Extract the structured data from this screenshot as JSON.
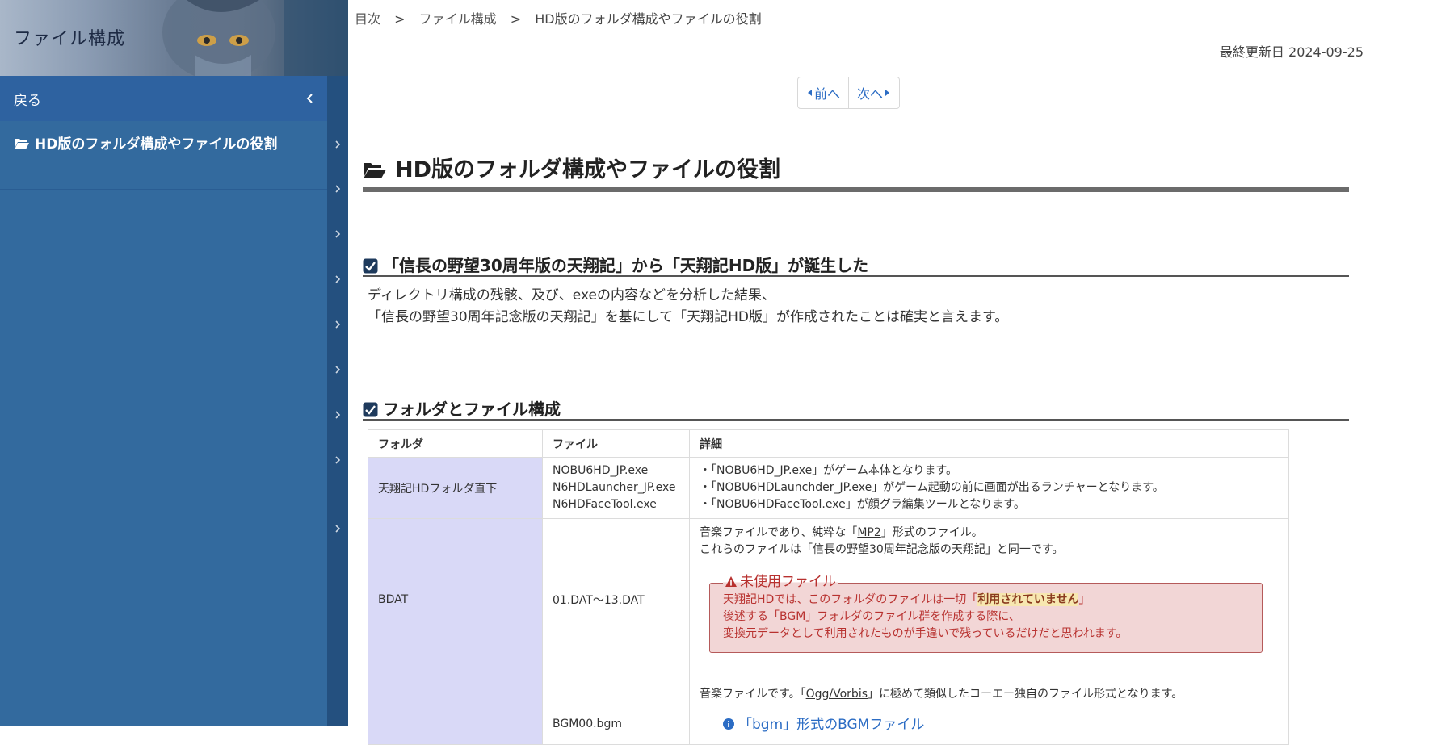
{
  "sidebar": {
    "title": "ファイル構成",
    "back_label": "戻る",
    "current_item": "HD版のフォルダ構成やファイルの役割",
    "rail_chevrons": 9
  },
  "breadcrumb": {
    "items": [
      "目次",
      "ファイル構成",
      "HD版のフォルダ構成やファイルの役割"
    ],
    "separator": ">"
  },
  "updated": "最終更新日 2024-09-25",
  "pager": {
    "prev": "前へ",
    "next": "次へ"
  },
  "page_heading": "HD版のフォルダ構成やファイルの役割",
  "sections": [
    {
      "title": "「信長の野望30周年版の天翔記」から「天翔記HD版」が誕生した"
    },
    {
      "title": "フォルダとファイル構成"
    }
  ],
  "intro": {
    "line1": "ディレクトリ構成の残骸、及び、exeの内容などを分析した結果、",
    "line2": "「信長の野望30周年記念版の天翔記」を基にして「天翔記HD版」が作成されたことは確実と言えます。"
  },
  "table": {
    "headers": [
      "フォルダ",
      "ファイル",
      "詳細"
    ],
    "row1": {
      "folder": "天翔記HDフォルダ直下",
      "files": [
        "NOBU6HD_JP.exe",
        "N6HDLauncher_JP.exe",
        "N6HDFaceTool.exe"
      ],
      "details": [
        "「NOBU6HD_JP.exe」がゲーム本体となります。",
        "「NOBU6HDLaunchder_JP.exe」がゲーム起動の前に画面が出るランチャーとなります。",
        "「NOBU6HDFaceTool.exe」が顔グラ編集ツールとなります。"
      ]
    },
    "row2": {
      "folder": "BDAT",
      "files": "01.DAT～13.DAT",
      "detail_pre": "音楽ファイルであり、純粋な「",
      "detail_link": "MP2",
      "detail_post": "」形式のファイル。",
      "detail_line2": "これらのファイルは「信長の野望30周年記念版の天翔記」と同一です。",
      "warning": {
        "title": "未使用ファイル",
        "line1_pre": "天翔記HDでは、このフォルダのファイルは一切「",
        "line1_strong": "利用されていません",
        "line1_post": "」",
        "line2": "後述する「BGM」フォルダのファイル群を作成する際に、",
        "line3": "変換元データとして利用されたものが手違いで残っているだけだと思われます。"
      }
    },
    "row3": {
      "folder": "",
      "files": "BGM00.bgm",
      "detail_pre": "音楽ファイルです。「",
      "detail_link": "Ogg/Vorbis",
      "detail_post": "」に極めて類似したコーエー独自のファイル形式となります。",
      "info_title": "「bgm」形式のBGMファイル"
    }
  },
  "colors": {
    "sidebar_bg": "#336a9e",
    "back_row_bg": "#2e62a0",
    "folder_cell_bg": "#d9d9f7",
    "warning_bg": "#f2d6d6",
    "warning_text": "#b8312f",
    "link_blue": "#2b6cc4"
  },
  "icons": {
    "back": "chevron-left-icon",
    "current": "folder-open-icon",
    "rail": "chevron-right-icon",
    "prev": "caret-left-icon",
    "next": "caret-right-icon",
    "section": "check-square-icon",
    "warning": "warning-triangle-icon",
    "info": "info-circle-icon"
  }
}
